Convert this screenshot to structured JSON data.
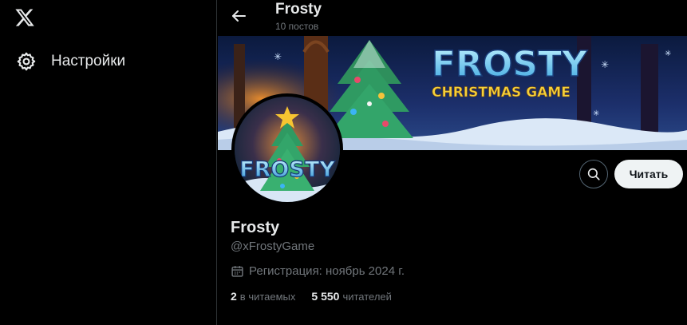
{
  "sidebar": {
    "logo_icon": "x-logo-icon",
    "items": [
      {
        "label": "Настройки",
        "icon": "gear-icon"
      }
    ]
  },
  "header": {
    "back_icon": "arrow-left-icon",
    "name": "Frosty",
    "posts_count": "10 постов"
  },
  "banner": {
    "title": "FROSTY",
    "subtitle": "CHRISTMAS GAME"
  },
  "avatar": {
    "text": "FROSTY"
  },
  "actions": {
    "search_icon": "search-icon",
    "follow_label": "Читать"
  },
  "profile": {
    "name": "Frosty",
    "handle": "@xFrostyGame",
    "calendar_icon": "calendar-icon",
    "joined": "Регистрация: ноябрь 2024 г.",
    "following_count": "2",
    "following_label": "в читаемых",
    "followers_count": "5 550",
    "followers_label": "читателей"
  },
  "colors": {
    "background": "#000000",
    "text_primary": "#e7e9ea",
    "text_secondary": "#71767b",
    "border": "#2f3336",
    "button_bg": "#eff3f4"
  }
}
